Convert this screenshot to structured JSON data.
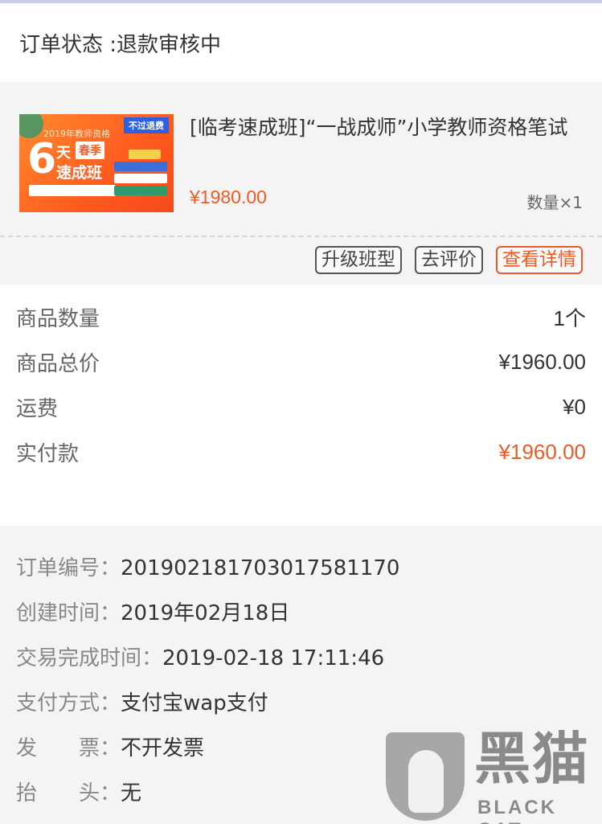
{
  "order_status": {
    "label": "订单状态 :",
    "value": "退款审核中"
  },
  "product": {
    "thumbnail": {
      "tag": "不过退费",
      "year_text": "2019年教师资格",
      "big_number": "6",
      "day_text": "天",
      "season_text": "春季",
      "course_text": "速成班"
    },
    "title": "[临考速成班]“一战成师”小学教师资格笔试",
    "price": "¥1980.00",
    "quantity": "数量×1",
    "buttons": {
      "upgrade": "升级班型",
      "review": "去评价",
      "details": "查看详情"
    }
  },
  "summary": [
    {
      "label": "商品数量",
      "value": "1个",
      "highlight": false
    },
    {
      "label": "商品总价",
      "value": "¥1960.00",
      "highlight": false
    },
    {
      "label": "运费",
      "value": "¥0",
      "highlight": false
    },
    {
      "label": "实付款",
      "value": "¥1960.00",
      "highlight": true
    }
  ],
  "details": [
    {
      "label": "订单编号：",
      "value": "201902181703017581170"
    },
    {
      "label": "创建时间：",
      "value": "2019年02月18日"
    },
    {
      "label": "交易完成时间：",
      "value": "2019-02-18 17:11:46"
    },
    {
      "label": "支付方式：",
      "value": "支付宝wap支付"
    },
    {
      "label": "发　　票：",
      "value": "不开发票"
    },
    {
      "label": "抬　　头：",
      "value": "无"
    }
  ],
  "watermark": {
    "cn": "黑猫",
    "en": "BLACK CAT"
  },
  "colors": {
    "accent": "#ee5a22",
    "section_bg": "#f4f4f4"
  }
}
